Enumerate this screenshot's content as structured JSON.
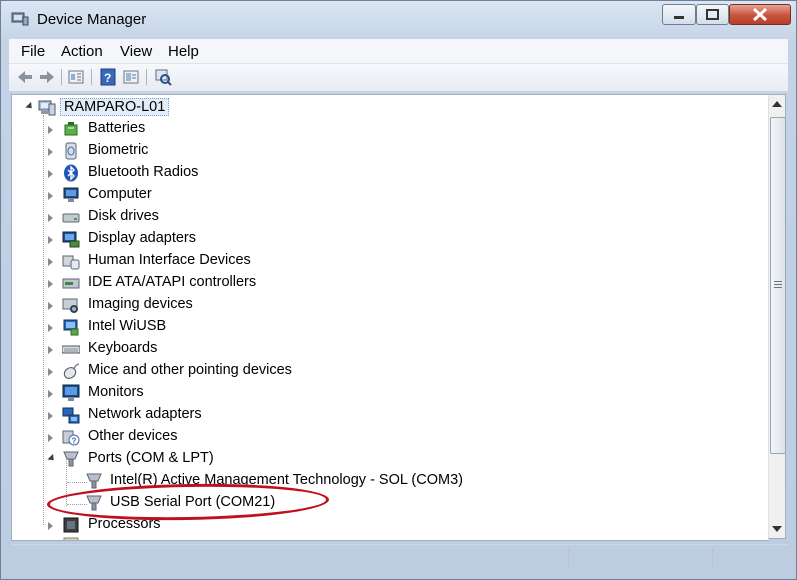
{
  "window": {
    "title": "Device Manager",
    "title_icon": "device-manager-icon"
  },
  "menu": [
    {
      "label": "File"
    },
    {
      "label": "Action"
    },
    {
      "label": "View"
    },
    {
      "label": "Help"
    }
  ],
  "toolbar": [
    "back-icon",
    "forward-icon",
    "properties-icon",
    "help-icon",
    "show-hidden-icon",
    "scan-hardware-icon"
  ],
  "tree": {
    "root": "RAMPARO-L01",
    "categories": [
      {
        "label": "Batteries",
        "icon": "battery-icon"
      },
      {
        "label": "Biometric",
        "icon": "biometric-icon"
      },
      {
        "label": "Bluetooth Radios",
        "icon": "bluetooth-icon"
      },
      {
        "label": "Computer",
        "icon": "computer-icon"
      },
      {
        "label": "Disk drives",
        "icon": "disk-drive-icon"
      },
      {
        "label": "Display adapters",
        "icon": "display-adapter-icon"
      },
      {
        "label": "Human Interface Devices",
        "icon": "hid-icon"
      },
      {
        "label": "IDE ATA/ATAPI controllers",
        "icon": "ide-controller-icon"
      },
      {
        "label": "Imaging devices",
        "icon": "camera-icon"
      },
      {
        "label": "Intel WiUSB",
        "icon": "wiusb-icon"
      },
      {
        "label": "Keyboards",
        "icon": "keyboard-icon"
      },
      {
        "label": "Mice and other pointing devices",
        "icon": "mouse-icon"
      },
      {
        "label": "Monitors",
        "icon": "monitor-icon"
      },
      {
        "label": "Network adapters",
        "icon": "network-adapter-icon"
      },
      {
        "label": "Other devices",
        "icon": "other-devices-icon"
      },
      {
        "label": "Ports (COM & LPT)",
        "icon": "port-icon",
        "expanded": true
      },
      {
        "label": "Processors",
        "icon": "processor-icon"
      }
    ],
    "ports_children": [
      {
        "label": "Intel(R) Active Management Technology - SOL (COM3)",
        "icon": "port-icon"
      },
      {
        "label": "USB Serial Port (COM21)",
        "icon": "port-icon",
        "highlighted": true
      }
    ]
  },
  "annotation": {
    "color": "#c0101e",
    "target": "USB Serial Port (COM21)"
  }
}
